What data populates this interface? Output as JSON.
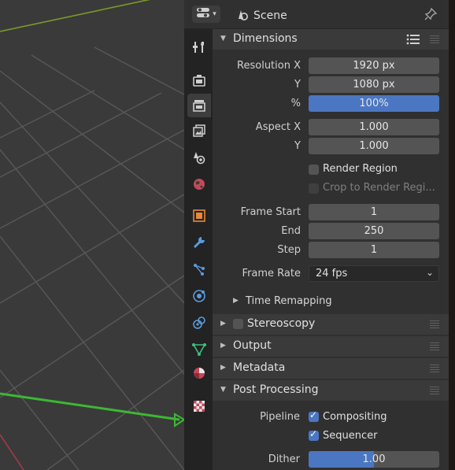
{
  "header": {
    "editor_icon": "properties-editor-icon",
    "scene_icon": "scene-icon",
    "scene_label": "Scene",
    "pin_icon": "pin-icon"
  },
  "tabs": [
    {
      "name": "tool",
      "icon": "tool-icon"
    },
    {
      "name": "render",
      "icon": "render-icon"
    },
    {
      "name": "output",
      "icon": "output-icon",
      "active": true
    },
    {
      "name": "view-layer",
      "icon": "view-layer-icon"
    },
    {
      "name": "scene",
      "icon": "scene-icon"
    },
    {
      "name": "world",
      "icon": "world-icon"
    },
    {
      "name": "object",
      "icon": "object-icon"
    },
    {
      "name": "modifier",
      "icon": "wrench-icon"
    },
    {
      "name": "particles",
      "icon": "particles-icon"
    },
    {
      "name": "physics",
      "icon": "physics-icon"
    },
    {
      "name": "constraints",
      "icon": "constraints-icon"
    },
    {
      "name": "data",
      "icon": "data-icon"
    },
    {
      "name": "material",
      "icon": "material-icon"
    },
    {
      "name": "texture",
      "icon": "texture-icon"
    }
  ],
  "dimensions": {
    "title": "Dimensions",
    "resolution_x_label": "Resolution X",
    "resolution_x": "1920 px",
    "y_label": "Y",
    "resolution_y": "1080 px",
    "percent_label": "%",
    "percent": "100%",
    "aspect_x_label": "Aspect X",
    "aspect_x": "1.000",
    "aspect_y_label": "Y",
    "aspect_y": "1.000",
    "render_region_label": "Render Region",
    "render_region_checked": false,
    "crop_label": "Crop to Render Regi...",
    "crop_checked": false,
    "frame_start_label": "Frame Start",
    "frame_start": "1",
    "end_label": "End",
    "frame_end": "250",
    "step_label": "Step",
    "frame_step": "1",
    "frame_rate_label": "Frame Rate",
    "frame_rate": "24 fps",
    "time_remapping_label": "Time Remapping"
  },
  "sections": {
    "stereoscopy": "Stereoscopy",
    "output": "Output",
    "metadata": "Metadata",
    "post_processing": "Post Processing"
  },
  "post_processing": {
    "pipeline_label": "Pipeline",
    "compositing_label": "Compositing",
    "compositing_checked": true,
    "sequencer_label": "Sequencer",
    "sequencer_checked": true,
    "dither_label": "Dither",
    "dither_value": "1.00",
    "dither_fraction": 0.5
  },
  "colors": {
    "accent": "#4b76c1",
    "panel_bg": "#303030",
    "field_bg": "#545454"
  }
}
